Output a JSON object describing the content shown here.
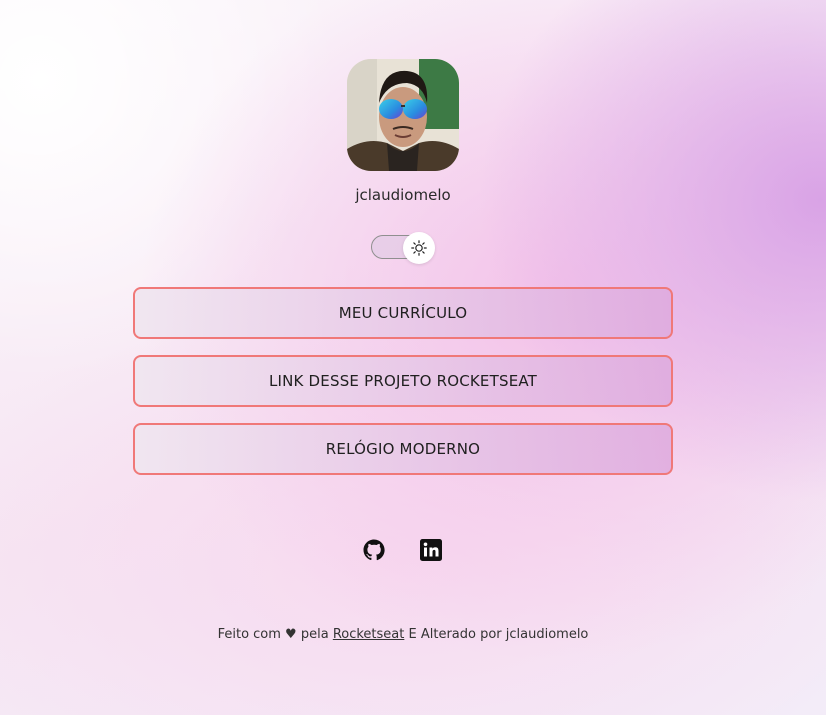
{
  "profile": {
    "username": "jclaudiomelo",
    "avatar_alt": "jclaudiomelo"
  },
  "theme_switch": {
    "icon": "sun-icon",
    "state": "light"
  },
  "links": [
    {
      "label": "MEU CURRÍCULO"
    },
    {
      "label": "LINK DESSE PROJETO ROCKETSEAT"
    },
    {
      "label": "RELÓGIO MODERNO"
    }
  ],
  "social": [
    {
      "icon": "github-icon"
    },
    {
      "icon": "linkedin-icon"
    }
  ],
  "footer": {
    "prefix": "Feito com ♥ pela ",
    "link_text": "Rocketseat",
    "suffix": " E Alterado por jclaudiomelo"
  },
  "colors": {
    "button_border": "#f07878",
    "accent_purple": "#d9a3e6",
    "text": "#1a1a1a"
  }
}
